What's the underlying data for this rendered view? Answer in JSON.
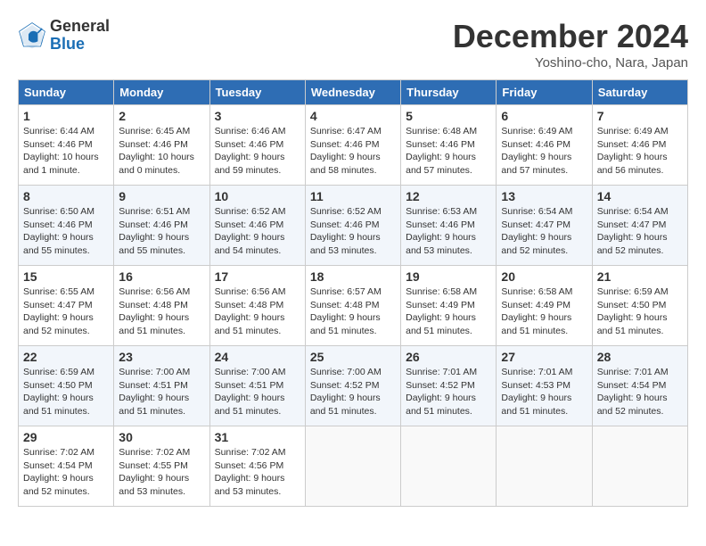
{
  "logo": {
    "general": "General",
    "blue": "Blue"
  },
  "header": {
    "month": "December 2024",
    "location": "Yoshino-cho, Nara, Japan"
  },
  "days_of_week": [
    "Sunday",
    "Monday",
    "Tuesday",
    "Wednesday",
    "Thursday",
    "Friday",
    "Saturday"
  ],
  "weeks": [
    [
      {
        "day": "1",
        "info": "Sunrise: 6:44 AM\nSunset: 4:46 PM\nDaylight: 10 hours\nand 1 minute."
      },
      {
        "day": "2",
        "info": "Sunrise: 6:45 AM\nSunset: 4:46 PM\nDaylight: 10 hours\nand 0 minutes."
      },
      {
        "day": "3",
        "info": "Sunrise: 6:46 AM\nSunset: 4:46 PM\nDaylight: 9 hours\nand 59 minutes."
      },
      {
        "day": "4",
        "info": "Sunrise: 6:47 AM\nSunset: 4:46 PM\nDaylight: 9 hours\nand 58 minutes."
      },
      {
        "day": "5",
        "info": "Sunrise: 6:48 AM\nSunset: 4:46 PM\nDaylight: 9 hours\nand 57 minutes."
      },
      {
        "day": "6",
        "info": "Sunrise: 6:49 AM\nSunset: 4:46 PM\nDaylight: 9 hours\nand 57 minutes."
      },
      {
        "day": "7",
        "info": "Sunrise: 6:49 AM\nSunset: 4:46 PM\nDaylight: 9 hours\nand 56 minutes."
      }
    ],
    [
      {
        "day": "8",
        "info": "Sunrise: 6:50 AM\nSunset: 4:46 PM\nDaylight: 9 hours\nand 55 minutes."
      },
      {
        "day": "9",
        "info": "Sunrise: 6:51 AM\nSunset: 4:46 PM\nDaylight: 9 hours\nand 55 minutes."
      },
      {
        "day": "10",
        "info": "Sunrise: 6:52 AM\nSunset: 4:46 PM\nDaylight: 9 hours\nand 54 minutes."
      },
      {
        "day": "11",
        "info": "Sunrise: 6:52 AM\nSunset: 4:46 PM\nDaylight: 9 hours\nand 53 minutes."
      },
      {
        "day": "12",
        "info": "Sunrise: 6:53 AM\nSunset: 4:46 PM\nDaylight: 9 hours\nand 53 minutes."
      },
      {
        "day": "13",
        "info": "Sunrise: 6:54 AM\nSunset: 4:47 PM\nDaylight: 9 hours\nand 52 minutes."
      },
      {
        "day": "14",
        "info": "Sunrise: 6:54 AM\nSunset: 4:47 PM\nDaylight: 9 hours\nand 52 minutes."
      }
    ],
    [
      {
        "day": "15",
        "info": "Sunrise: 6:55 AM\nSunset: 4:47 PM\nDaylight: 9 hours\nand 52 minutes."
      },
      {
        "day": "16",
        "info": "Sunrise: 6:56 AM\nSunset: 4:48 PM\nDaylight: 9 hours\nand 51 minutes."
      },
      {
        "day": "17",
        "info": "Sunrise: 6:56 AM\nSunset: 4:48 PM\nDaylight: 9 hours\nand 51 minutes."
      },
      {
        "day": "18",
        "info": "Sunrise: 6:57 AM\nSunset: 4:48 PM\nDaylight: 9 hours\nand 51 minutes."
      },
      {
        "day": "19",
        "info": "Sunrise: 6:58 AM\nSunset: 4:49 PM\nDaylight: 9 hours\nand 51 minutes."
      },
      {
        "day": "20",
        "info": "Sunrise: 6:58 AM\nSunset: 4:49 PM\nDaylight: 9 hours\nand 51 minutes."
      },
      {
        "day": "21",
        "info": "Sunrise: 6:59 AM\nSunset: 4:50 PM\nDaylight: 9 hours\nand 51 minutes."
      }
    ],
    [
      {
        "day": "22",
        "info": "Sunrise: 6:59 AM\nSunset: 4:50 PM\nDaylight: 9 hours\nand 51 minutes."
      },
      {
        "day": "23",
        "info": "Sunrise: 7:00 AM\nSunset: 4:51 PM\nDaylight: 9 hours\nand 51 minutes."
      },
      {
        "day": "24",
        "info": "Sunrise: 7:00 AM\nSunset: 4:51 PM\nDaylight: 9 hours\nand 51 minutes."
      },
      {
        "day": "25",
        "info": "Sunrise: 7:00 AM\nSunset: 4:52 PM\nDaylight: 9 hours\nand 51 minutes."
      },
      {
        "day": "26",
        "info": "Sunrise: 7:01 AM\nSunset: 4:52 PM\nDaylight: 9 hours\nand 51 minutes."
      },
      {
        "day": "27",
        "info": "Sunrise: 7:01 AM\nSunset: 4:53 PM\nDaylight: 9 hours\nand 51 minutes."
      },
      {
        "day": "28",
        "info": "Sunrise: 7:01 AM\nSunset: 4:54 PM\nDaylight: 9 hours\nand 52 minutes."
      }
    ],
    [
      {
        "day": "29",
        "info": "Sunrise: 7:02 AM\nSunset: 4:54 PM\nDaylight: 9 hours\nand 52 minutes."
      },
      {
        "day": "30",
        "info": "Sunrise: 7:02 AM\nSunset: 4:55 PM\nDaylight: 9 hours\nand 53 minutes."
      },
      {
        "day": "31",
        "info": "Sunrise: 7:02 AM\nSunset: 4:56 PM\nDaylight: 9 hours\nand 53 minutes."
      },
      {
        "day": "",
        "info": ""
      },
      {
        "day": "",
        "info": ""
      },
      {
        "day": "",
        "info": ""
      },
      {
        "day": "",
        "info": ""
      }
    ]
  ]
}
